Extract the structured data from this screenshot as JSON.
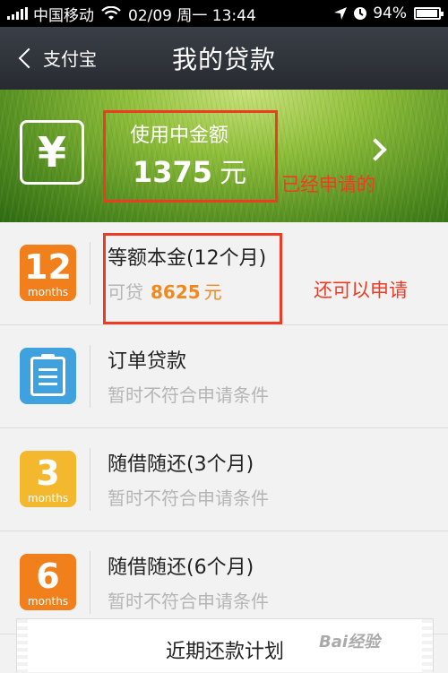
{
  "status": {
    "carrier": "中国移动",
    "datetime": "02/09 周一 13:44",
    "battery_level": "94%",
    "battery_fraction": 0.94
  },
  "nav": {
    "back_label": "支付宝",
    "title": "我的贷款"
  },
  "banner": {
    "label": "使用中金额",
    "amount": "1375",
    "unit": "元"
  },
  "loans": [
    {
      "icon": "12-months-icon",
      "icon_num": "12",
      "icon_unit": "months",
      "title": "等额本金(12个月)",
      "sub_label": "可贷",
      "amount": "8625",
      "unit": "元"
    },
    {
      "icon": "clipboard-icon",
      "title": "订单贷款",
      "sub": "暂时不符合申请条件"
    },
    {
      "icon": "3-months-icon",
      "icon_num": "3",
      "icon_unit": "months",
      "title": "随借随还(3个月)",
      "sub": "暂时不符合申请条件"
    },
    {
      "icon": "6-months-icon",
      "icon_num": "6",
      "icon_unit": "months",
      "title": "随借随还(6个月)",
      "sub": "暂时不符合申请条件"
    }
  ],
  "annotations": {
    "applied": "已经申请的",
    "can_apply": "还可以申请"
  },
  "bottom": {
    "title": "近期还款计划"
  },
  "watermark": "Bai经验",
  "colors": {
    "annotation": "#ef3b23",
    "amount_orange": "#f08a1e",
    "icon_orange": "#f07f1c",
    "icon_yellow": "#f4b82e",
    "icon_blue": "#3fa2df"
  }
}
